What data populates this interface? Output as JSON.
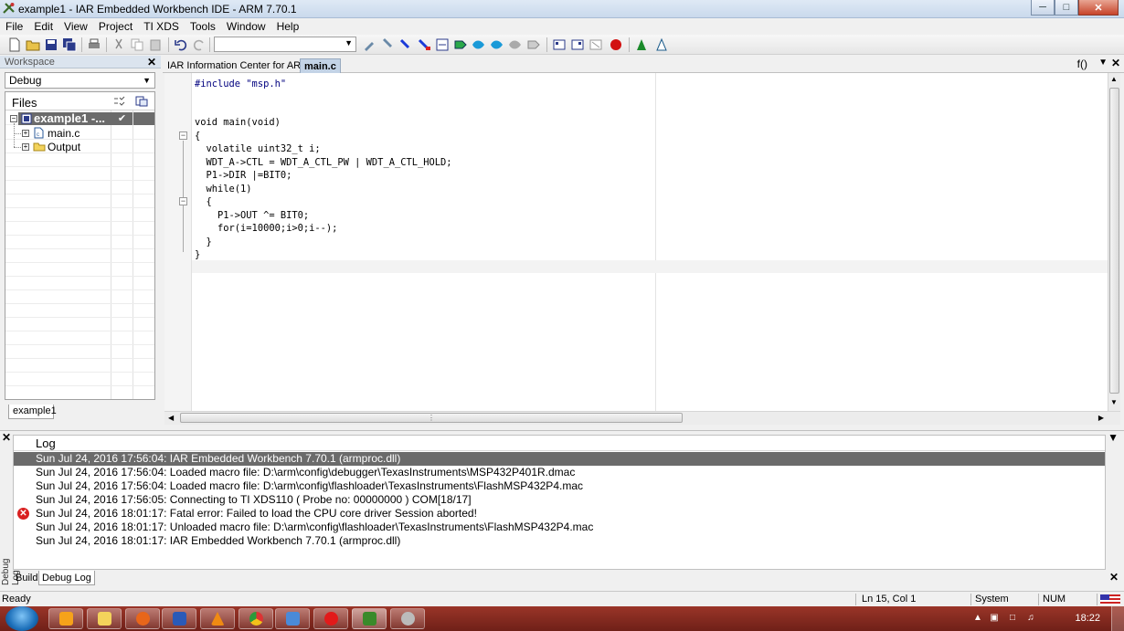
{
  "window": {
    "title": "example1 - IAR Embedded Workbench IDE - ARM 7.70.1"
  },
  "menu": [
    "File",
    "Edit",
    "View",
    "Project",
    "TI XDS",
    "Tools",
    "Window",
    "Help"
  ],
  "workspace": {
    "header": "Workspace",
    "config": "Debug",
    "files_header": "Files",
    "tree": {
      "project": "example1 -...",
      "file": "main.c",
      "folder": "Output"
    },
    "tab": "example1"
  },
  "editor": {
    "tabs": [
      "IAR Information Center for ARM",
      "main.c"
    ],
    "function_combo": "f()",
    "code": [
      "#include \"msp.h\"",
      "",
      "",
      "void main(void)",
      "{",
      "  volatile uint32_t i;",
      "  WDT_A->CTL = WDT_A_CTL_PW | WDT_A_CTL_HOLD;",
      "  P1->DIR |=BIT0;",
      "  while(1)",
      "  {",
      "    P1->OUT ^= BIT0;",
      "    for(i=10000;i>0;i--);",
      "  }",
      "}"
    ]
  },
  "log": {
    "header": "Log",
    "entries": [
      {
        "text": "Sun Jul 24, 2016 17:56:04: IAR Embedded Workbench 7.70.1 (armproc.dll)",
        "selected": true,
        "error": false
      },
      {
        "text": "Sun Jul 24, 2016 17:56:04: Loaded macro file: D:\\arm\\config\\debugger\\TexasInstruments\\MSP432P401R.dmac",
        "selected": false,
        "error": false
      },
      {
        "text": "Sun Jul 24, 2016 17:56:04: Loaded macro file: D:\\arm\\config\\flashloader\\TexasInstruments\\FlashMSP432P4.mac",
        "selected": false,
        "error": false
      },
      {
        "text": "Sun Jul 24, 2016 17:56:05: Connecting to TI XDS110 ( Probe no: 00000000 ) COM[18/17]",
        "selected": false,
        "error": false
      },
      {
        "text": "Sun Jul 24, 2016 18:01:17: Fatal error: Failed to load the CPU core driver   Session aborted!",
        "selected": false,
        "error": true
      },
      {
        "text": "Sun Jul 24, 2016 18:01:17: Unloaded macro file: D:\\arm\\config\\flashloader\\TexasInstruments\\FlashMSP432P4.mac",
        "selected": false,
        "error": false
      },
      {
        "text": "Sun Jul 24, 2016 18:01:17: IAR Embedded Workbench 7.70.1 (armproc.dll)",
        "selected": false,
        "error": false
      }
    ],
    "side_label": "Debug Log",
    "tabs": [
      "Build",
      "Debug Log"
    ]
  },
  "status": {
    "ready": "Ready",
    "position": "Ln 15, Col 1",
    "encoding": "System",
    "numlock": "NUM"
  },
  "taskbar": {
    "clock": "18:22"
  },
  "colors": {
    "selection": "#6b6b6b",
    "keyword": "#00007f",
    "number": "#00a000",
    "error": "#d92020",
    "taskbar": "#8a2d22"
  }
}
